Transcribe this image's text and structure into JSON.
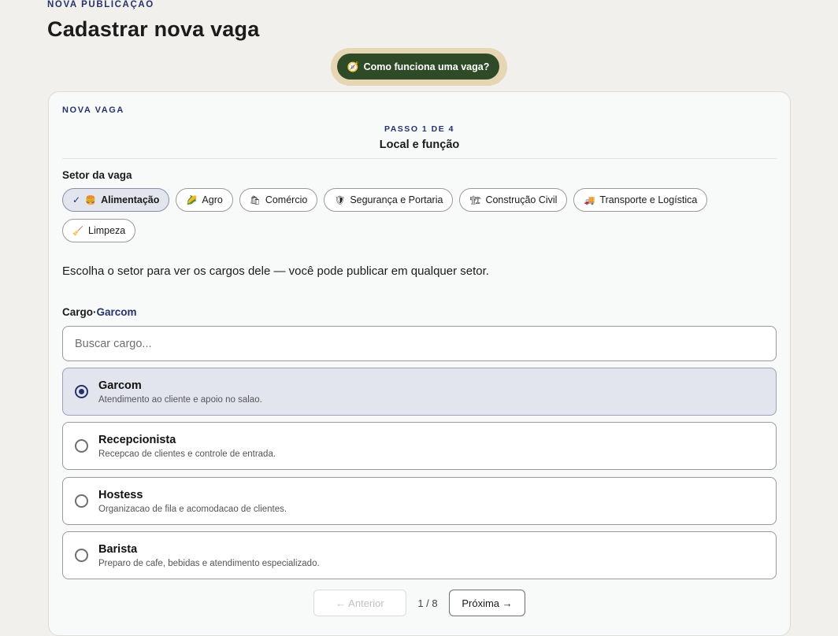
{
  "header": {
    "eyebrow": "NOVA PUBLICAÇÃO",
    "title": "Cadastrar nova vaga",
    "help_button": "Como funciona uma vaga?"
  },
  "card": {
    "eyebrow": "NOVA VAGA",
    "step_label": "PASSO 1 DE 4",
    "step_title": "Local e função",
    "sector_label": "Setor da vaga",
    "sectors": [
      {
        "label": "Alimentação",
        "icon": "burger-icon",
        "glyph": "🍔",
        "selected": true
      },
      {
        "label": "Agro",
        "icon": "corn-icon",
        "glyph": "🌽",
        "selected": false
      },
      {
        "label": "Comércio",
        "icon": "shopping-bags-icon",
        "glyph": "🛍",
        "selected": false
      },
      {
        "label": "Segurança e Portaria",
        "icon": "shield-icon",
        "glyph": "🛡",
        "selected": false
      },
      {
        "label": "Construção Civil",
        "icon": "crane-icon",
        "glyph": "🏗",
        "selected": false
      },
      {
        "label": "Transporte e Logística",
        "icon": "truck-icon",
        "glyph": "🚚",
        "selected": false
      },
      {
        "label": "Limpeza",
        "icon": "broom-icon",
        "glyph": "🧹",
        "selected": false
      }
    ],
    "helper_text": "Escolha o setor para ver os cargos dele — você pode publicar em qualquer setor.",
    "cargo_label": "Cargo",
    "cargo_separator": "·",
    "cargo_selected": "Garcom",
    "search_placeholder": "Buscar cargo...",
    "options": [
      {
        "title": "Garcom",
        "desc": "Atendimento ao cliente e apoio no salao.",
        "selected": true
      },
      {
        "title": "Recepcionista",
        "desc": "Recepcao de clientes e controle de entrada.",
        "selected": false
      },
      {
        "title": "Hostess",
        "desc": "Organizacao de fila e acomodacao de clientes.",
        "selected": false
      },
      {
        "title": "Barista",
        "desc": "Preparo de cafe, bebidas e atendimento especializado.",
        "selected": false
      }
    ],
    "pager": {
      "prev": "← Anterior",
      "count": "1 / 8",
      "next": "Próxima →"
    }
  },
  "colors": {
    "accent": "#26336b",
    "help_button_bg": "#2f4a26",
    "selected_bg": "#e3e5ee"
  }
}
